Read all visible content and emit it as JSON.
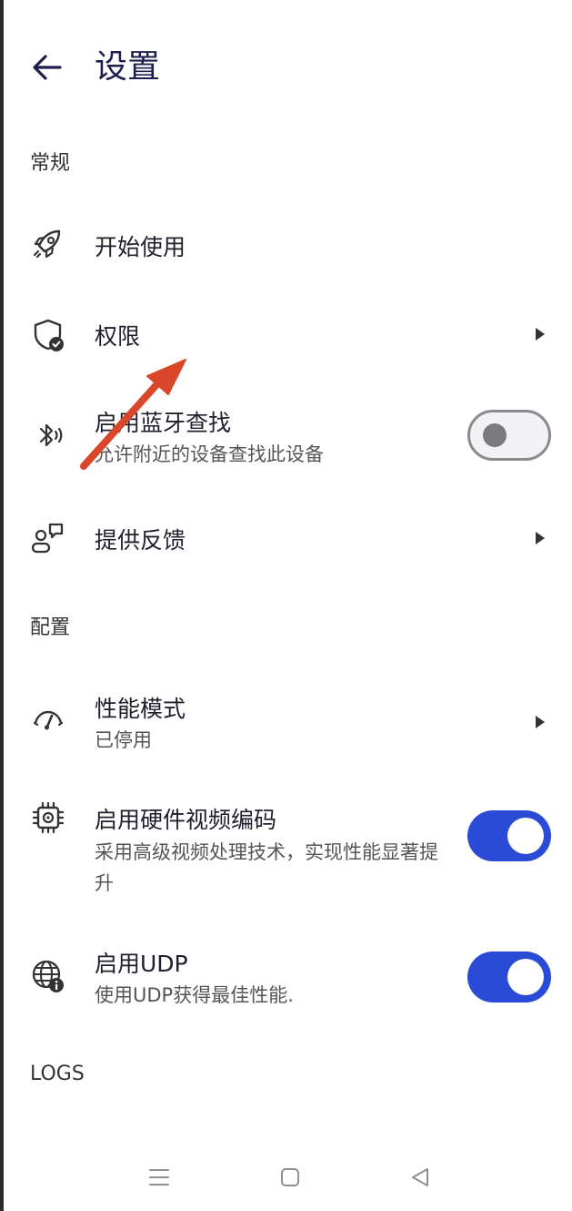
{
  "header": {
    "title": "设置"
  },
  "sections": {
    "general": "常规",
    "config": "配置",
    "logs": "LOGS"
  },
  "items": {
    "get_started": {
      "label": "开始使用",
      "icon": "rocket-icon"
    },
    "permissions": {
      "label": "权限",
      "icon": "shield-check-icon"
    },
    "bluetooth": {
      "label": "启用蓝牙查找",
      "sub": "允许附近的设备查找此设备",
      "icon": "bluetooth-icon",
      "enabled": false
    },
    "feedback": {
      "label": "提供反馈",
      "icon": "feedback-icon"
    },
    "performance": {
      "label": "性能模式",
      "sub": "已停用",
      "icon": "speedometer-icon"
    },
    "hw_video": {
      "label": "启用硬件视频编码",
      "sub": "采用高级视频处理技术，实现性能显著提升",
      "icon": "chip-icon",
      "enabled": true
    },
    "udp": {
      "label": "启用UDP",
      "sub": "使用UDP获得最佳性能.",
      "icon": "globe-info-icon",
      "enabled": true
    }
  },
  "colors": {
    "accent": "#2a4bd6",
    "annotation_arrow": "#d9472b"
  }
}
